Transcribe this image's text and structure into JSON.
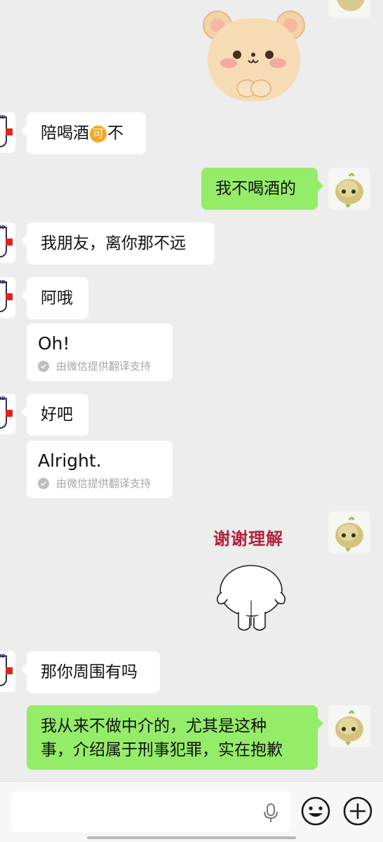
{
  "messages": [
    {
      "side": "right",
      "type": "sticker",
      "name": "bear-sticker"
    },
    {
      "side": "left",
      "type": "text",
      "text": "陪喝酒",
      "emoji": "可",
      "text_after": "不"
    },
    {
      "side": "right",
      "type": "text",
      "text": "我不喝酒的"
    },
    {
      "side": "left",
      "type": "text",
      "text": "我朋友，离你那不远"
    },
    {
      "side": "left",
      "type": "text",
      "text": "阿哦",
      "translation": "Oh!",
      "translation_note": "由微信提供翻译支持"
    },
    {
      "side": "left",
      "type": "text",
      "text": "好吧",
      "translation": "Alright.",
      "translation_note": "由微信提供翻译支持"
    },
    {
      "side": "right",
      "type": "sticker",
      "name": "thanks-sticker",
      "caption": "谢谢理解"
    },
    {
      "side": "left",
      "type": "text",
      "text": "那你周围有吗"
    },
    {
      "side": "right",
      "type": "text",
      "line1": "我从来不做中介的，尤其是这种",
      "line2": "事，介绍属于刑事犯罪，实在抱歉"
    }
  ],
  "input_bar": {
    "value": "",
    "icons": [
      "voice-icon",
      "emoji-icon",
      "plus-icon"
    ]
  },
  "colors": {
    "background": "#ededed",
    "incoming": "#ffffff",
    "outgoing": "#95ec69",
    "sticker_text": "#b0233c"
  }
}
